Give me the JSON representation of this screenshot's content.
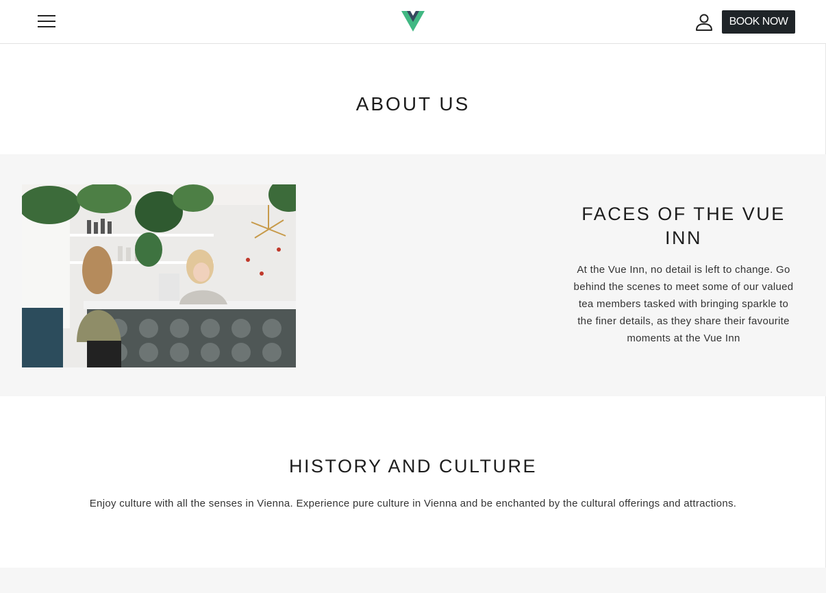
{
  "header": {
    "menu_icon": "hamburger-menu-icon",
    "logo_icon": "vue-logo-icon",
    "user_icon": "user-account-icon",
    "book_now_label": "BOOK NOW"
  },
  "main": {
    "page_title": "ABOUT US",
    "faces": {
      "title": "FACES OF THE VUE INN",
      "body": "At the Vue Inn, no detail is left to change. Go behind the scenes to meet some of our valued tea members tasked with bringing sparkle to the finer details, as they share their favourite moments at the Vue Inn"
    },
    "history": {
      "title": "HISTORY AND CULTURE",
      "body": "Enjoy culture with all the senses in Vienna. Experience pure culture in Vienna and be enchanted by the cultural offerings and attractions."
    }
  },
  "colors": {
    "logo_green": "#41b883",
    "logo_dark": "#35495e",
    "button_bg": "#1f2428",
    "section_bg": "#f6f6f6"
  }
}
